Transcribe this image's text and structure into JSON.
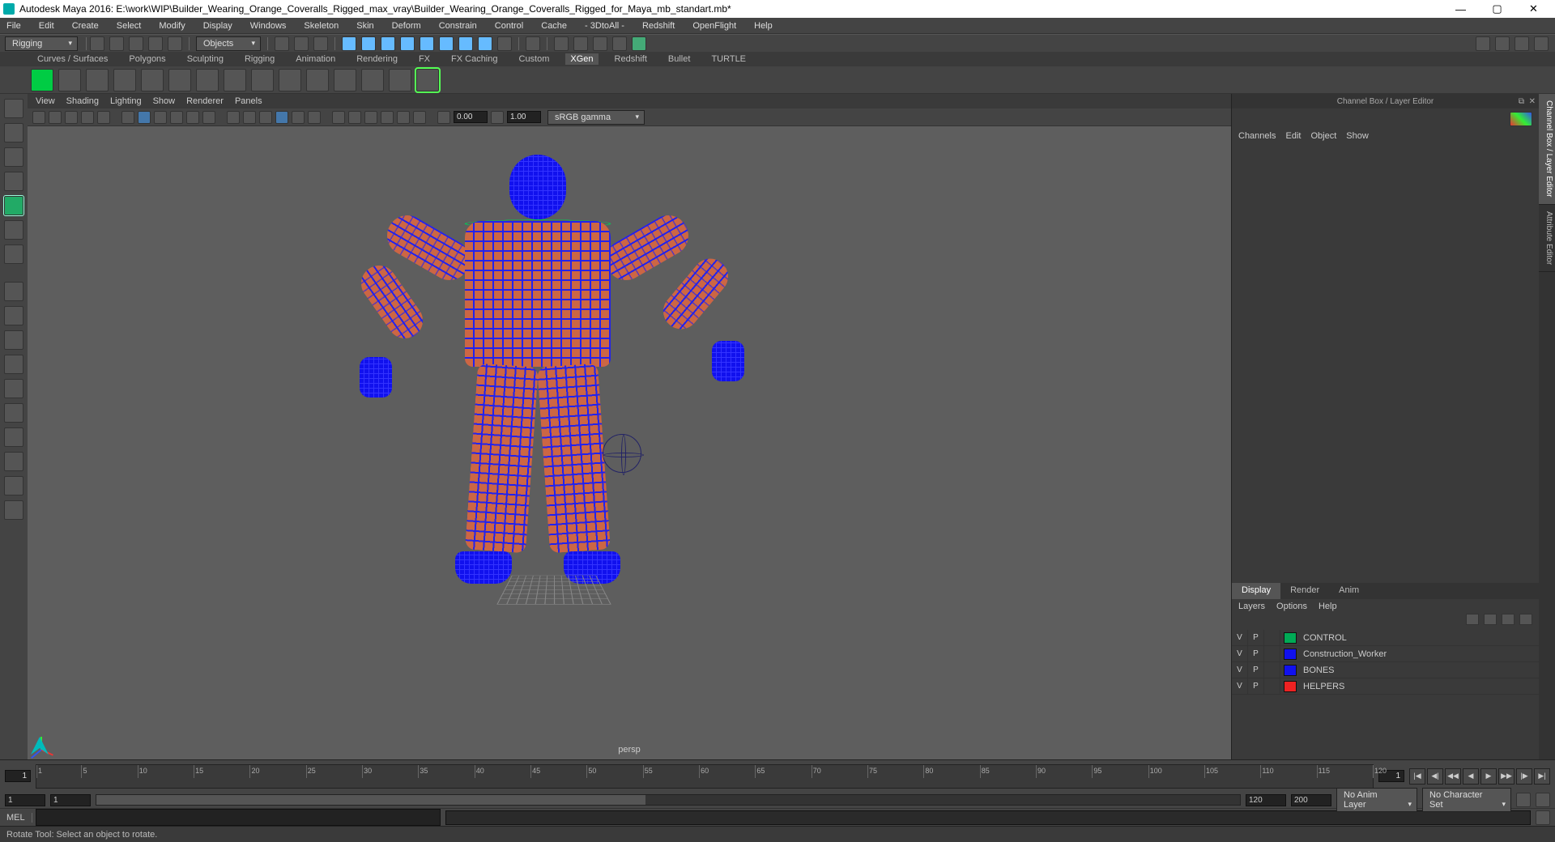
{
  "title": "Autodesk Maya 2016: E:\\work\\WIP\\Builder_Wearing_Orange_Coveralls_Rigged_max_vray\\Builder_Wearing_Orange_Coveralls_Rigged_for_Maya_mb_standart.mb*",
  "menubar": [
    "File",
    "Edit",
    "Create",
    "Select",
    "Modify",
    "Display",
    "Windows",
    "Skeleton",
    "Skin",
    "Deform",
    "Constrain",
    "Control",
    "Cache",
    "- 3DtoAll -",
    "Redshift",
    "OpenFlight",
    "Help"
  ],
  "moduleDropdown": "Rigging",
  "objectsDropdown": "Objects",
  "shelves": [
    "Curves / Surfaces",
    "Polygons",
    "Sculpting",
    "Rigging",
    "Animation",
    "Rendering",
    "FX",
    "FX Caching",
    "Custom",
    "XGen",
    "Redshift",
    "Bullet",
    "TURTLE"
  ],
  "activeShelf": "XGen",
  "panelMenus": [
    "View",
    "Shading",
    "Lighting",
    "Show",
    "Renderer",
    "Panels"
  ],
  "nearClip": "0.00",
  "farClip": "1.00",
  "colorMgmt": "sRGB gamma",
  "cameraLabel": "persp",
  "channelBox": {
    "title": "Channel Box / Layer Editor",
    "menus": [
      "Channels",
      "Edit",
      "Object",
      "Show"
    ]
  },
  "layerEditor": {
    "tabs": [
      "Display",
      "Render",
      "Anim"
    ],
    "activeTab": "Display",
    "menus": [
      "Layers",
      "Options",
      "Help"
    ],
    "layers": [
      {
        "v": "V",
        "p": "P",
        "color": "#0a5",
        "name": "CONTROL"
      },
      {
        "v": "V",
        "p": "P",
        "color": "#11e",
        "name": "Construction_Worker"
      },
      {
        "v": "V",
        "p": "P",
        "color": "#11e",
        "name": "BONES"
      },
      {
        "v": "V",
        "p": "P",
        "color": "#e22",
        "name": "HELPERS"
      }
    ]
  },
  "sideTabs": [
    "Channel Box / Layer Editor",
    "Attribute Editor"
  ],
  "timeline": {
    "current": "1",
    "start": "1",
    "end": "120",
    "boxStart": "1",
    "boxEnd": "120",
    "fps": "200",
    "animLayer": "No Anim Layer",
    "charSet": "No Character Set",
    "ticks": [
      1,
      5,
      10,
      15,
      20,
      25,
      30,
      35,
      40,
      45,
      50,
      55,
      60,
      65,
      70,
      75,
      80,
      85,
      90,
      95,
      100,
      105,
      110,
      115,
      120
    ]
  },
  "cmd": {
    "lang": "MEL"
  },
  "helpline": "Rotate Tool: Select an object to rotate."
}
